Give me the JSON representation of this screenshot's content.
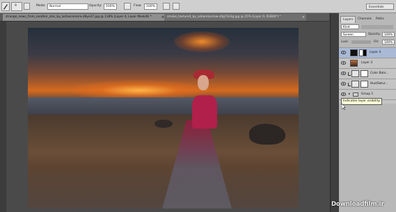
{
  "options_bar": {
    "mode_label": "Mode:",
    "mode_value": "Normal",
    "opacity_label": "Opacity:",
    "opacity_value": "100%",
    "flow_label": "Flow:",
    "flow_value": "100%",
    "brush_size": "9"
  },
  "workspace": {
    "label": "Essentials"
  },
  "tabs": [
    {
      "label": "strange_news_from_another_star_by_kellascamera-d9ye37.jpg @ 118% (Layer 4, Layer Mask/8) *",
      "close": "×"
    },
    {
      "label": "smoke_texture4_by_ashenmorrow-d3g74z3g.jpg @ 25% (Layer 0, RGB/8*) *",
      "close": "×"
    }
  ],
  "layers_panel": {
    "tabs": [
      "Layers",
      "Channels",
      "Paths"
    ],
    "kind_label": "Kind",
    "blend_mode": "Screen",
    "opacity_label": "Opacity:",
    "opacity_value": "100%",
    "lock_label": "Lock:",
    "fill_label": "Fill:",
    "fill_value": "100%",
    "layers": [
      {
        "name": "Layer 4"
      },
      {
        "name": "Layer 3"
      },
      {
        "name": "Color Bala..."
      },
      {
        "name": "Hue/Satur..."
      },
      {
        "name": "Group 1"
      }
    ],
    "tooltip": "Indicates layer visibility"
  },
  "watermark": "Downloadfilm.ir",
  "colors": {
    "accent_selected": "#a9b9d6",
    "tooltip_bg": "#fbfbd8"
  }
}
